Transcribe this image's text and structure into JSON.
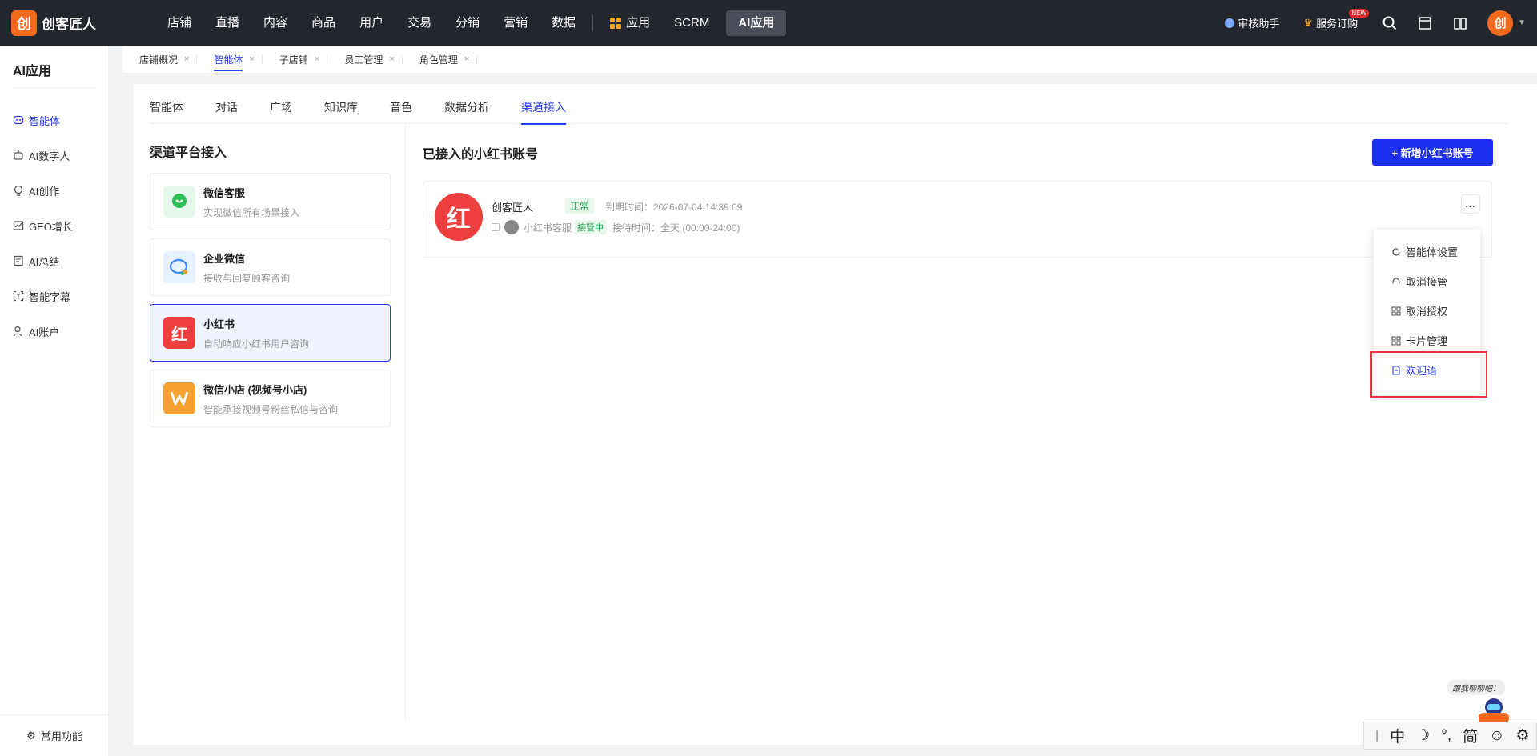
{
  "brand": {
    "name": "创客匠人",
    "logo_char": "创"
  },
  "topnav": {
    "items": [
      "店铺",
      "直播",
      "内容",
      "商品",
      "用户",
      "交易",
      "分销",
      "营销",
      "数据"
    ],
    "app": "应用",
    "scrm": "SCRM",
    "active": "AI应用"
  },
  "topright": {
    "audit": "审核助手",
    "subscription": "服务订购",
    "new_badge": "NEW"
  },
  "sidebar": {
    "title": "AI应用",
    "items": [
      {
        "label": "智能体",
        "icon": "agent-icon"
      },
      {
        "label": "AI数字人",
        "icon": "robot-icon"
      },
      {
        "label": "AI创作",
        "icon": "bulb-icon"
      },
      {
        "label": "GEO增长",
        "icon": "chart-icon"
      },
      {
        "label": "AI总结",
        "icon": "summary-icon"
      },
      {
        "label": "智能字幕",
        "icon": "subtitle-icon"
      },
      {
        "label": "AI账户",
        "icon": "user-icon"
      }
    ],
    "bottom": "常用功能"
  },
  "page_tabs": [
    {
      "label": "店铺概况"
    },
    {
      "label": "智能体"
    },
    {
      "label": "子店铺"
    },
    {
      "label": "员工管理"
    },
    {
      "label": "角色管理"
    }
  ],
  "subtabs": [
    "智能体",
    "对话",
    "广场",
    "知识库",
    "音色",
    "数据分析",
    "渠道接入"
  ],
  "left_panel": {
    "title": "渠道平台接入",
    "platforms": [
      {
        "name": "微信客服",
        "desc": "实现微信所有场景接入",
        "color": "#2fbf5a"
      },
      {
        "name": "企业微信",
        "desc": "接收与回复顾客咨询",
        "color": "#3a86ff"
      },
      {
        "name": "小红书",
        "desc": "自动响应小红书用户咨询",
        "color": "#ee3f3f"
      },
      {
        "name": "微信小店 (视频号小店)",
        "desc": "智能承接视频号粉丝私信与咨询",
        "color": "#f5a030"
      }
    ]
  },
  "right_panel": {
    "title": "已接入的小红书账号",
    "add_button": "+ 新增小红书账号",
    "account": {
      "avatar_char": "红",
      "name": "创客匠人",
      "status": "正常",
      "expire": "到期时间：2026-07-04 14:39:09",
      "agent": "小红书客服",
      "tag": "接管中",
      "reception": "接待时间：全天 (00:00-24:00)",
      "more": "..."
    }
  },
  "dropdown": [
    "智能体设置",
    "取消接管",
    "取消授权",
    "卡片管理",
    "欢迎语"
  ],
  "assistant": {
    "hint": "跟我聊聊吧！",
    "label": "AI助手"
  },
  "ime": [
    "|",
    "中",
    "☽",
    "°,",
    "简",
    "☺",
    "⚙"
  ]
}
